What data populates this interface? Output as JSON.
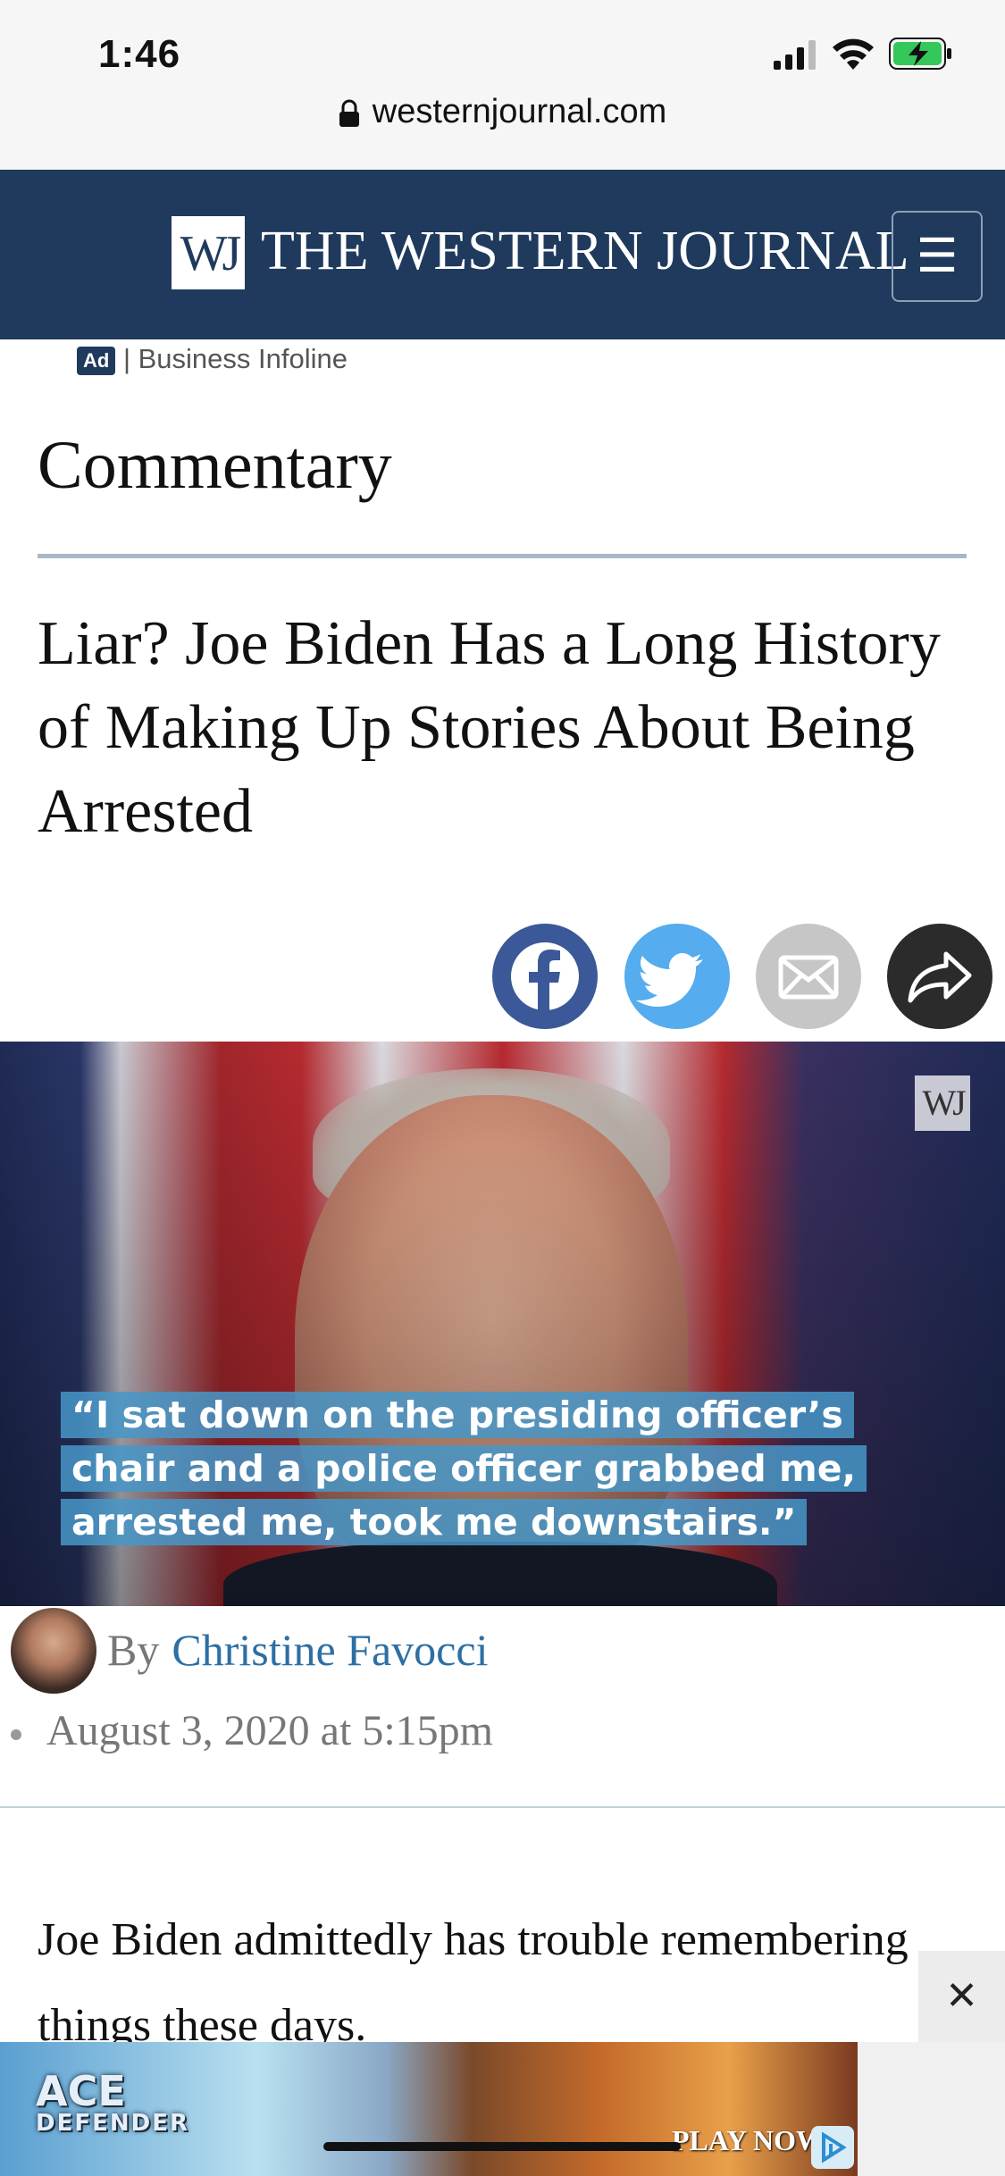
{
  "status_bar": {
    "time": "1:46"
  },
  "browser": {
    "url": "westernjournal.com"
  },
  "site_header": {
    "logo_mark": "WJ",
    "title": "THE WESTERN JOURNAL",
    "menu_glyph": "☰"
  },
  "ad_label": {
    "badge": "Ad",
    "sponsor": "| Business Infoline"
  },
  "article": {
    "section": "Commentary",
    "headline": "Liar? Joe Biden Has a Long History of Making Up Stories About Being Arrested",
    "hero_quote": "“I sat down on the presiding officer’s chair and a police officer grabbed me, arrested me, took me downstairs.”",
    "hero_watermark": "WJ",
    "byline_prefix": "By",
    "author": "Christine Favocci",
    "date": "August 3, 2020 at 5:15pm",
    "body_first": "Joe Biden admittedly has trouble remembering things these days."
  },
  "share": [
    {
      "name": "facebook",
      "color": "#3b5998",
      "icon": "facebook-icon"
    },
    {
      "name": "twitter",
      "color": "#55acee",
      "icon": "twitter-icon"
    },
    {
      "name": "email",
      "color": "#c6c6c6",
      "icon": "email-icon"
    },
    {
      "name": "share",
      "color": "#2b2b2b",
      "icon": "share-arrow-icon"
    }
  ],
  "bottom_ad": {
    "game_logo": "ACE",
    "game_sub": "DEFENDER",
    "cta": "PLAY NOW",
    "close_glyph": "✕"
  },
  "colors": {
    "header_bg": "#1f3a5c",
    "author_link": "#2d6fa3"
  }
}
